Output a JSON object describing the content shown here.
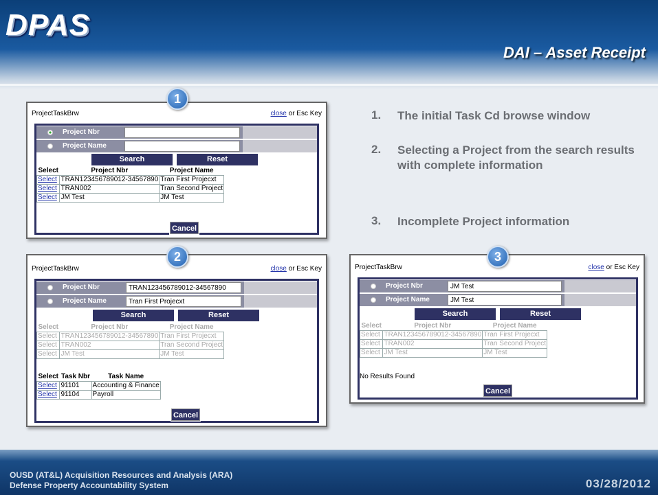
{
  "header": {
    "logo_text": "DPAS",
    "slide_title": "DAI – Asset Receipt"
  },
  "footer": {
    "org_line1": "OUSD (AT&L) Acquisition Resources and Analysis (ARA)",
    "org_line2": "Defense Property Accountability System",
    "date": "03/28/2012"
  },
  "steps": [
    {
      "num": "1.",
      "text": "The initial Task Cd browse window"
    },
    {
      "num": "2.",
      "text": "Selecting a Project from the search results with complete information"
    },
    {
      "num": "3.",
      "text": "Incomplete Project information"
    }
  ],
  "windows": [
    {
      "badge": "1",
      "title": "ProjectTaskBrw",
      "close_link": "close",
      "close_suffix": " or Esc Key",
      "radio1_label": "Project Nbr",
      "radio2_label": "Project Name",
      "input1_value": "",
      "input2_value": "",
      "search_label": "Search",
      "reset_label": "Reset",
      "project_headers": [
        "Select",
        "Project Nbr",
        "Project Name"
      ],
      "projects": [
        {
          "select": "Select",
          "nbr": "TRAN123456789012-34567890",
          "name": "Tran First Projecxt"
        },
        {
          "select": "Select",
          "nbr": "TRAN002",
          "name": "Tran Second Project"
        },
        {
          "select": "Select",
          "nbr": "JM Test",
          "name": "JM Test"
        }
      ],
      "cancel_label": "Cancel"
    },
    {
      "badge": "2",
      "title": "ProjectTaskBrw",
      "close_link": "close",
      "close_suffix": " or Esc Key",
      "radio1_label": "Project Nbr",
      "radio2_label": "Project Name",
      "input1_value": "TRAN123456789012-34567890",
      "input2_value": "Tran First Projecxt",
      "search_label": "Search",
      "reset_label": "Reset",
      "project_headers": [
        "Select",
        "Project Nbr",
        "Project Name"
      ],
      "projects": [
        {
          "select": "Select",
          "nbr": "TRAN123456789012-34567890",
          "name": "Tran First Projecxt"
        },
        {
          "select": "Select",
          "nbr": "TRAN002",
          "name": "Tran Second Project"
        },
        {
          "select": "Select",
          "nbr": "JM Test",
          "name": "JM Test"
        }
      ],
      "task_headers": [
        "Select",
        "Task Nbr",
        "Task Name"
      ],
      "tasks": [
        {
          "select": "Select",
          "nbr": "91101",
          "name": "Accounting & Finance"
        },
        {
          "select": "Select",
          "nbr": "91104",
          "name": "Payroll"
        }
      ],
      "cancel_label": "Cancel"
    },
    {
      "badge": "3",
      "title": "ProjectTaskBrw",
      "close_link": "close",
      "close_suffix": " or Esc Key",
      "radio1_label": "Project Nbr",
      "radio2_label": "Project Name",
      "input1_value": "JM Test",
      "input2_value": "JM Test",
      "search_label": "Search",
      "reset_label": "Reset",
      "project_headers": [
        "Select",
        "Project Nbr",
        "Project Name"
      ],
      "projects": [
        {
          "select": "Select",
          "nbr": "TRAN123456789012-34567890",
          "name": "Tran First Projecxt"
        },
        {
          "select": "Select",
          "nbr": "TRAN002",
          "name": "Tran Second Project"
        },
        {
          "select": "Select",
          "nbr": "JM Test",
          "name": "JM Test"
        }
      ],
      "no_results": "No Results Found",
      "cancel_label": "Cancel"
    }
  ]
}
